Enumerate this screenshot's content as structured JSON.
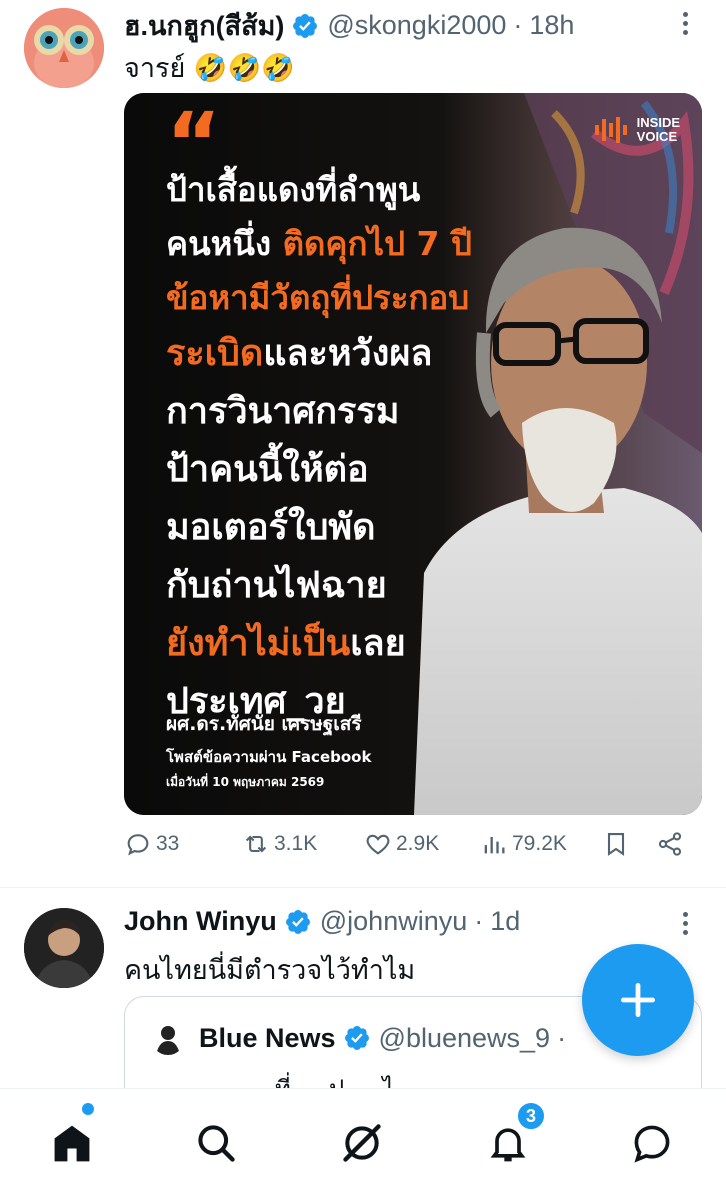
{
  "tweet1": {
    "name": "ฮ.นกฮูก(สีส้ม)",
    "handle": "@skongki2000",
    "separator": "·",
    "time": "18h",
    "text": "จารย์ 🤣🤣🤣",
    "media": {
      "quote_mark": "“",
      "brand_line1": "INSIDE",
      "brand_line2": "VOICE",
      "lines": [
        {
          "pre": "ป้าเสื้อแดงที่ลำพูน",
          "hl": "",
          "post": ""
        },
        {
          "pre": "คนหนึ่ง ",
          "hl": "ติดคุกไป 7 ปี",
          "post": ""
        },
        {
          "pre": "",
          "hl": "ข้อหามีวัตถุที่ประกอบ",
          "post": ""
        },
        {
          "pre": "",
          "hl": "ระเบิด",
          "post": "และหวังผล"
        },
        {
          "pre": "การวินาศกรรม",
          "hl": "",
          "post": ""
        },
        {
          "pre": "ป้าคนนี้ให้ต่อ",
          "hl": "",
          "post": ""
        },
        {
          "pre": "มอเตอร์ใบพัด",
          "hl": "",
          "post": ""
        },
        {
          "pre": "กับถ่านไฟฉาย",
          "hl": "",
          "post": ""
        },
        {
          "pre": "",
          "hl": "ยังทำไม่เป็น",
          "post": "เลย"
        },
        {
          "pre": "ประเทศ_วย",
          "hl": "",
          "post": ""
        }
      ],
      "attribution": "ผศ.ดร.ทัศนัย เศรษฐเสรี",
      "source": "โพสต์ข้อความผ่าน Facebook",
      "date": "เมื่อวันที่ 10 พฤษภาคม 2569"
    },
    "stats": {
      "replies": "33",
      "reposts": "3.1K",
      "likes": "2.9K",
      "views": "79.2K"
    }
  },
  "tweet2": {
    "name": "John Winyu",
    "handle": "@johnwinyu",
    "separator": "·",
    "time": "1d",
    "text": "คนไทยนี่มีตำรวจไว้ทำไม",
    "quoted": {
      "name": "Blue News",
      "handle": "@bluenews_9",
      "separator": "·",
      "preview": "ที่ ... ป ... ไ"
    }
  },
  "nav": {
    "notifications_badge": "3"
  },
  "colors": {
    "accent": "#1d9bf0",
    "highlight_orange": "#f36b21",
    "muted": "#536471"
  },
  "icons": [
    "more-icon",
    "verified-icon",
    "reply-icon",
    "repost-icon",
    "like-icon",
    "views-icon",
    "bookmark-icon",
    "share-icon",
    "compose-icon",
    "home-icon",
    "search-icon",
    "grok-icon",
    "notifications-icon",
    "messages-icon"
  ]
}
